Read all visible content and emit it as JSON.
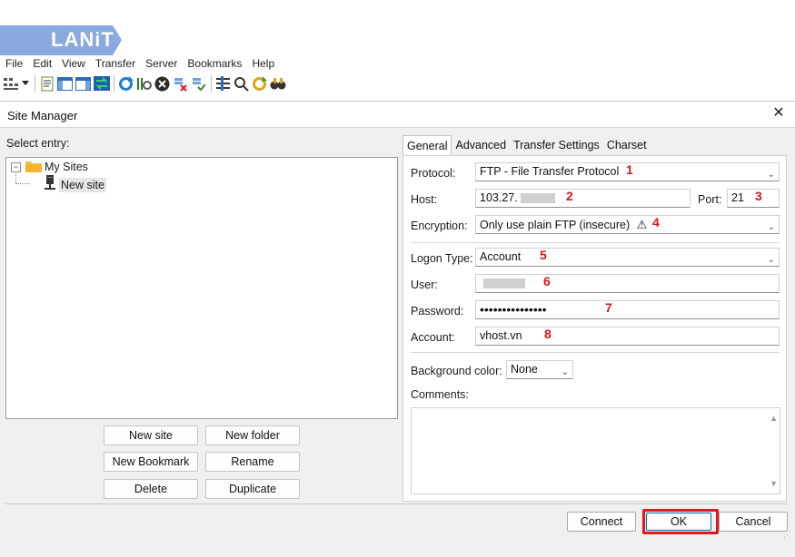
{
  "logo": {
    "text": "LANiT"
  },
  "menu": [
    "File",
    "Edit",
    "View",
    "Transfer",
    "Server",
    "Bookmarks",
    "Help"
  ],
  "toolbar": {
    "icons": [
      "site-manager-icon",
      "dropdown-arrow-icon",
      "message-log-icon",
      "local-tree-icon",
      "remote-tree-icon",
      "transfer-queue-icon",
      "refresh-icon",
      "process-queue-icon",
      "cancel-icon",
      "disconnect-icon",
      "reconnect-icon",
      "directory-filter-icon",
      "compare-icon",
      "synchronized-browsing-icon",
      "search-icon"
    ]
  },
  "dialog": {
    "title": "Site Manager",
    "close": "✕",
    "select_entry": "Select entry:",
    "tree": {
      "root": "My Sites",
      "child": "New site"
    },
    "buttons": {
      "new_site": "New site",
      "new_folder": "New folder",
      "new_bookmark": "New Bookmark",
      "rename": "Rename",
      "delete": "Delete",
      "duplicate": "Duplicate"
    },
    "tabs": [
      "General",
      "Advanced",
      "Transfer Settings",
      "Charset"
    ],
    "general": {
      "protocol_label": "Protocol:",
      "protocol_value": "FTP - File Transfer Protocol",
      "host_label": "Host:",
      "host_value": "103.27.",
      "port_label": "Port:",
      "port_value": "21",
      "encryption_label": "Encryption:",
      "encryption_value": "Only use plain FTP (insecure)",
      "warning_glyph": "⚠",
      "logon_label": "Logon Type:",
      "logon_value": "Account",
      "user_label": "User:",
      "password_label": "Password:",
      "password_value": "•••••••••••••••",
      "account_label": "Account:",
      "account_value": "vhost.vn",
      "bg_color_label": "Background color:",
      "bg_color_value": "None",
      "comments_label": "Comments:"
    },
    "annotations": [
      "1",
      "2",
      "3",
      "4",
      "5",
      "6",
      "7",
      "8"
    ],
    "footer": {
      "connect": "Connect",
      "ok": "OK",
      "cancel": "Cancel"
    }
  },
  "colors": {
    "annotation_red": "#d9141b",
    "ok_highlight": "#e01a1a",
    "logo_blue": "#8aa9e0"
  }
}
